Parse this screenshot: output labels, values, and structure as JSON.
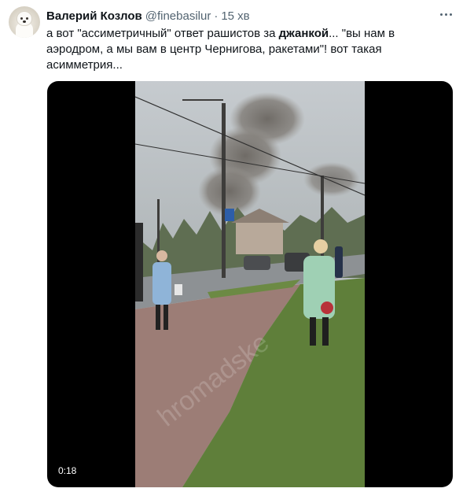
{
  "tweet": {
    "author_name": "Валерий Козлов",
    "author_handle": "@finebasilur",
    "separator": "·",
    "timestamp": "15 хв",
    "text_parts": [
      "а вот \"ассиметричный\" ответ рашистов за ",
      "джанкой",
      "... \"вы нам в аэродром, а мы вам в центр Чернигова, ракетами\"! вот такая асимметрия..."
    ],
    "media": {
      "type": "video",
      "duration": "0:18",
      "watermark": "hromadske"
    }
  },
  "icons": {
    "more": "more-horizontal-icon"
  },
  "colors": {
    "primary_text": "#0f1419",
    "secondary_text": "#536471",
    "media_bg": "#000000"
  }
}
